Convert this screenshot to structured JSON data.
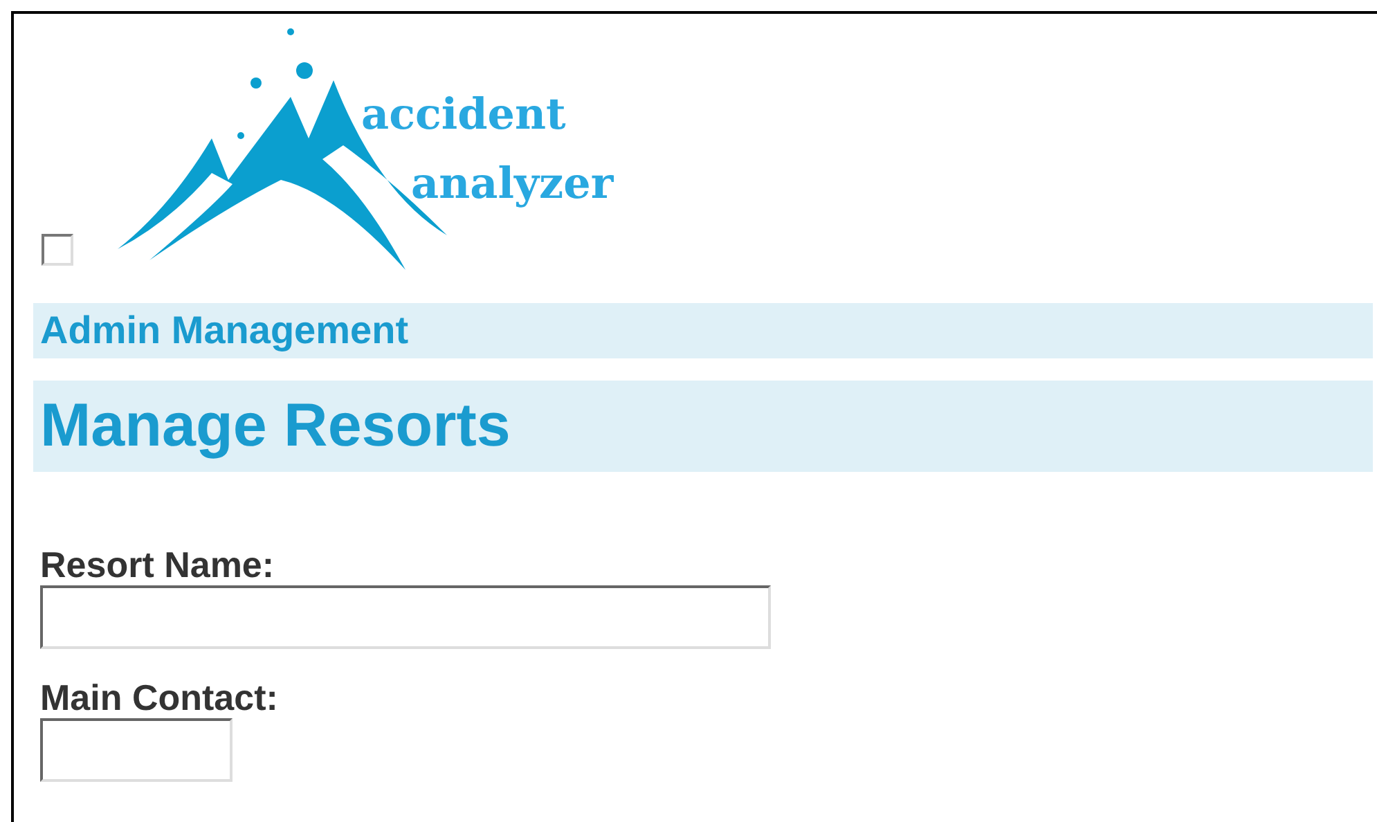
{
  "header": {
    "checkbox": {
      "checked": false
    },
    "logo": {
      "lines": [
        "accident",
        "analyzer"
      ]
    }
  },
  "section_title": "Admin Management",
  "page_title": "Manage Resorts",
  "fields": [
    {
      "label": "Resort Name:",
      "kind": "wide"
    },
    {
      "label": "Main Contact:",
      "kind": "narrow"
    }
  ]
}
